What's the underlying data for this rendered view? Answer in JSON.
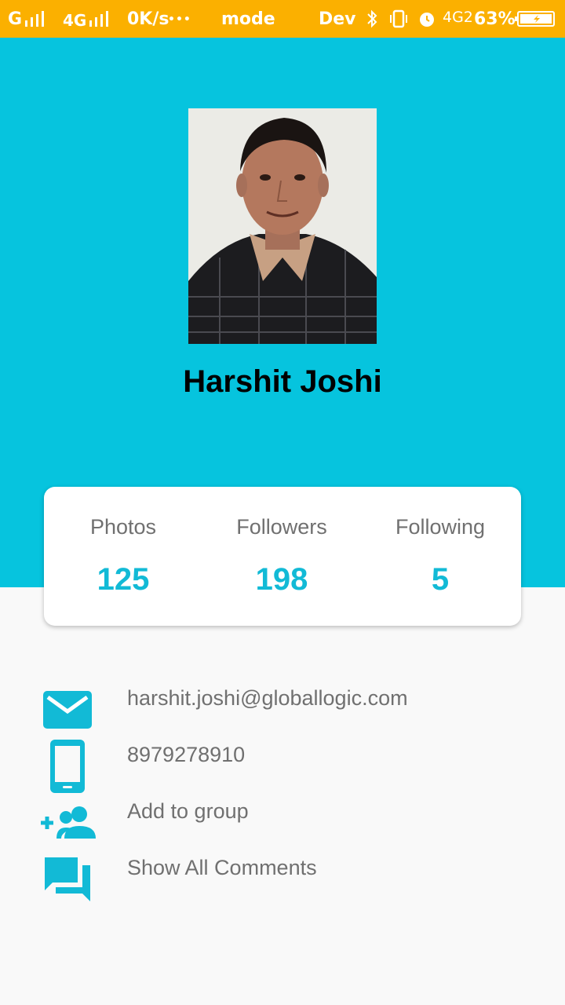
{
  "status_bar": {
    "signal1": "G",
    "signal2": "4G",
    "speed": "0K/s",
    "dots": "•••",
    "mode_text": "mode",
    "dev_text": "Dev",
    "network": "4G2",
    "battery": "63%"
  },
  "profile": {
    "name": "Harshit Joshi"
  },
  "stats": [
    {
      "label": "Photos",
      "value": "125"
    },
    {
      "label": "Followers",
      "value": "198"
    },
    {
      "label": "Following",
      "value": "5"
    }
  ],
  "details": {
    "email": "harshit.joshi@globallogic.com",
    "phone": "8979278910",
    "add_group": "Add to group",
    "comments": "Show All Comments"
  },
  "colors": {
    "status_bar": "#fbb000",
    "header": "#06c4de",
    "accent": "#12bad6",
    "label_text": "#707070"
  }
}
